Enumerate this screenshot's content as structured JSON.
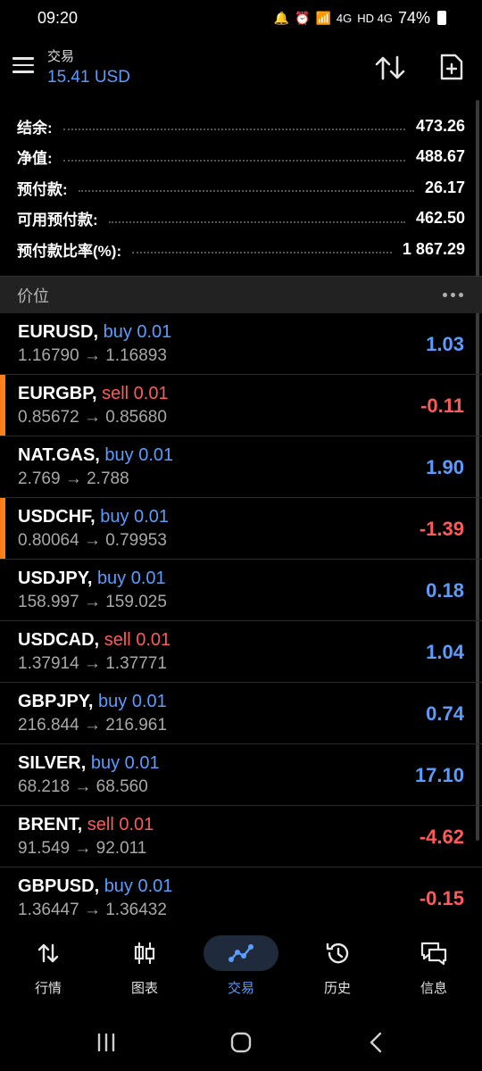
{
  "status_bar": {
    "time": "09:20",
    "network_1": "4G",
    "network_2": "HD 4G",
    "battery": "74%"
  },
  "header": {
    "title": "交易",
    "subtitle": "15.41 USD",
    "sort_icon": "sort-arrows-icon",
    "new_order_icon": "new-document-icon"
  },
  "summary": [
    {
      "label": "结余:",
      "value": "473.26"
    },
    {
      "label": "净值:",
      "value": "488.67"
    },
    {
      "label": "预付款:",
      "value": "26.17"
    },
    {
      "label": "可用预付款:",
      "value": "462.50"
    },
    {
      "label": "预付款比率(%):",
      "value": "1 867.29"
    }
  ],
  "section": {
    "title": "价位"
  },
  "positions": [
    {
      "symbol": "EURUSD,",
      "side": "buy 0.01",
      "type": "buy",
      "prices": "1.16790 → 1.16893",
      "profit": "1.03",
      "sign": "pos",
      "accent": false
    },
    {
      "symbol": "EURGBP,",
      "side": "sell 0.01",
      "type": "sell",
      "prices": "0.85672 → 0.85680",
      "profit": "-0.11",
      "sign": "neg",
      "accent": true
    },
    {
      "symbol": "NAT.GAS,",
      "side": "buy 0.01",
      "type": "buy",
      "prices": "2.769 → 2.788",
      "profit": "1.90",
      "sign": "pos",
      "accent": false
    },
    {
      "symbol": "USDCHF,",
      "side": "buy 0.01",
      "type": "buy",
      "prices": "0.80064 → 0.79953",
      "profit": "-1.39",
      "sign": "neg",
      "accent": true
    },
    {
      "symbol": "USDJPY,",
      "side": "buy 0.01",
      "type": "buy",
      "prices": "158.997 → 159.025",
      "profit": "0.18",
      "sign": "pos",
      "accent": false
    },
    {
      "symbol": "USDCAD,",
      "side": "sell 0.01",
      "type": "sell",
      "prices": "1.37914 → 1.37771",
      "profit": "1.04",
      "sign": "pos",
      "accent": false
    },
    {
      "symbol": "GBPJPY,",
      "side": "buy 0.01",
      "type": "buy",
      "prices": "216.844 → 216.961",
      "profit": "0.74",
      "sign": "pos",
      "accent": false
    },
    {
      "symbol": "SILVER,",
      "side": "buy 0.01",
      "type": "buy",
      "prices": "68.218 → 68.560",
      "profit": "17.10",
      "sign": "pos",
      "accent": false
    },
    {
      "symbol": "BRENT,",
      "side": "sell 0.01",
      "type": "sell",
      "prices": "91.549 → 92.011",
      "profit": "-4.62",
      "sign": "neg",
      "accent": false
    },
    {
      "symbol": "GBPUSD,",
      "side": "buy 0.01",
      "type": "buy",
      "prices": "1.36447 → 1.36432",
      "profit": "-0.15",
      "sign": "neg",
      "accent": false
    }
  ],
  "bottom_nav": [
    {
      "label": "行情",
      "icon": "quotes-icon",
      "active": false
    },
    {
      "label": "图表",
      "icon": "chart-icon",
      "active": false
    },
    {
      "label": "交易",
      "icon": "trade-icon",
      "active": true
    },
    {
      "label": "历史",
      "icon": "history-icon",
      "active": false
    },
    {
      "label": "信息",
      "icon": "messages-icon",
      "active": false
    }
  ],
  "colors": {
    "accent_blue": "#5b9cff",
    "loss_red": "#ff5a5a",
    "marker_orange": "#ff7f1a",
    "background": "#000000"
  }
}
